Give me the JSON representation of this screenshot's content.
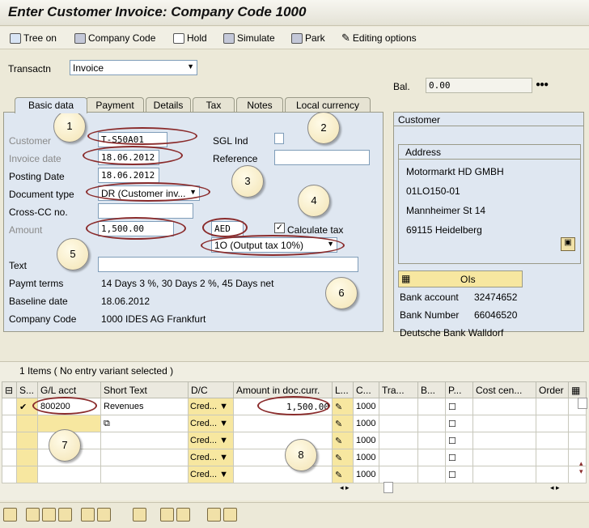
{
  "title": "Enter Customer Invoice: Company Code 1000",
  "toolbar": {
    "tree_on": "Tree on",
    "company_code": "Company Code",
    "hold": "Hold",
    "simulate": "Simulate",
    "park": "Park",
    "editing_options": "Editing options"
  },
  "transaction": {
    "label": "Transactn",
    "value": "Invoice"
  },
  "balance": {
    "label": "Bal.",
    "value": "0.00"
  },
  "tabs": [
    "Basic data",
    "Payment",
    "Details",
    "Tax",
    "Notes",
    "Local currency"
  ],
  "form": {
    "customer_label": "Customer",
    "customer_value": "T-S50A01",
    "sgl_label": "SGL Ind",
    "invoice_date_label": "Invoice date",
    "invoice_date_value": "18.06.2012",
    "reference_label": "Reference",
    "posting_date_label": "Posting Date",
    "posting_date_value": "18.06.2012",
    "doc_type_label": "Document type",
    "doc_type_value": "DR (Customer inv...",
    "crosscc_label": "Cross-CC no.",
    "amount_label": "Amount",
    "amount_value": "1,500.00",
    "currency_value": "AED",
    "calc_tax_label": "Calculate tax",
    "tax_code_value": "1O (Output tax 10%)",
    "text_label": "Text",
    "paymt_terms_label": "Paymt terms",
    "paymt_terms_value": "14 Days 3 %, 30 Days 2 %, 45 Days net",
    "baseline_label": "Baseline date",
    "baseline_value": "18.06.2012",
    "company_code_label": "Company Code",
    "company_code_value": "1000 IDES AG Frankfurt"
  },
  "customer_panel": {
    "header": "Customer",
    "address_header": "Address",
    "name": "Motormarkt HD GMBH",
    "line2": "01LO150-01",
    "street": "Mannheimer St 14",
    "city": "69115 Heidelberg",
    "ois_label": "OIs",
    "bank_account_label": "Bank account",
    "bank_account_value": "32474652",
    "bank_number_label": "Bank Number",
    "bank_number_value": "66046520",
    "bank_name": "Deutsche Bank Walldorf"
  },
  "items": {
    "header": "1 Items ( No entry variant selected )",
    "columns": [
      "S...",
      "G/L acct",
      "Short Text",
      "D/C",
      "Amount in doc.curr.",
      "L...",
      "C...",
      "Tra...",
      "B...",
      "P...",
      "Cost cen...",
      "Order"
    ],
    "rows": [
      {
        "gl": "800200",
        "text": "Revenues",
        "dc": "Cred...",
        "amount": "1,500.00",
        "cc": "1000"
      },
      {
        "gl": "",
        "text": "",
        "dc": "Cred...",
        "amount": "",
        "cc": "1000"
      },
      {
        "gl": "",
        "text": "",
        "dc": "Cred...",
        "amount": "",
        "cc": "1000"
      },
      {
        "gl": "",
        "text": "",
        "dc": "Cred...",
        "amount": "",
        "cc": "1000"
      },
      {
        "gl": "",
        "text": "",
        "dc": "Cred...",
        "amount": "",
        "cc": "1000"
      }
    ]
  },
  "callouts": [
    "1",
    "2",
    "3",
    "4",
    "5",
    "6",
    "7",
    "8"
  ],
  "colors": {
    "accent_ring": "#8a2b2b",
    "highlight": "#f7e7a0",
    "panel": "#dfe7f1"
  }
}
